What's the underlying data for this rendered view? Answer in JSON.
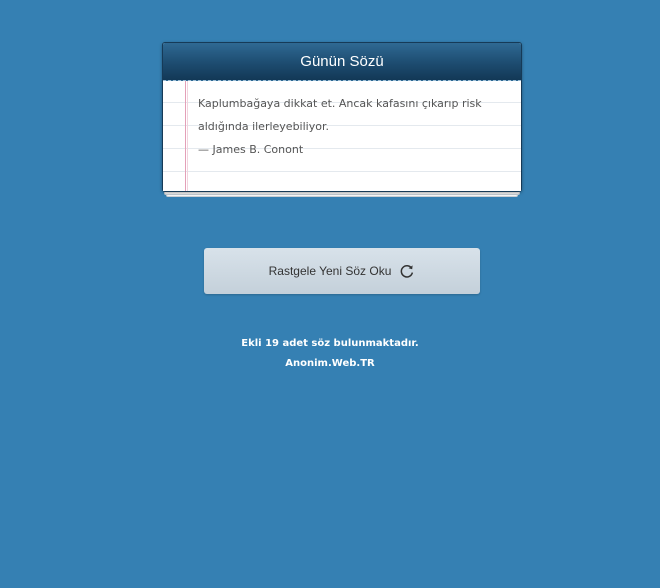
{
  "card": {
    "title": "Günün Sözü",
    "quote": "Kaplumbağaya dikkat et. Ancak kafasını çıkarıp risk aldığında ilerleyebiliyor.",
    "author": "— James B. Conont"
  },
  "random_button": {
    "label": "Rastgele Yeni Söz Oku",
    "icon": "refresh-icon"
  },
  "footer": {
    "count_text": "Ekli 19 adet söz bulunmaktadır.",
    "site_name": "Anonim.Web.TR"
  },
  "colors": {
    "background": "#3580b3",
    "header_dark": "#123856",
    "header_light": "#2f6993",
    "button": "#d0dbe3"
  }
}
